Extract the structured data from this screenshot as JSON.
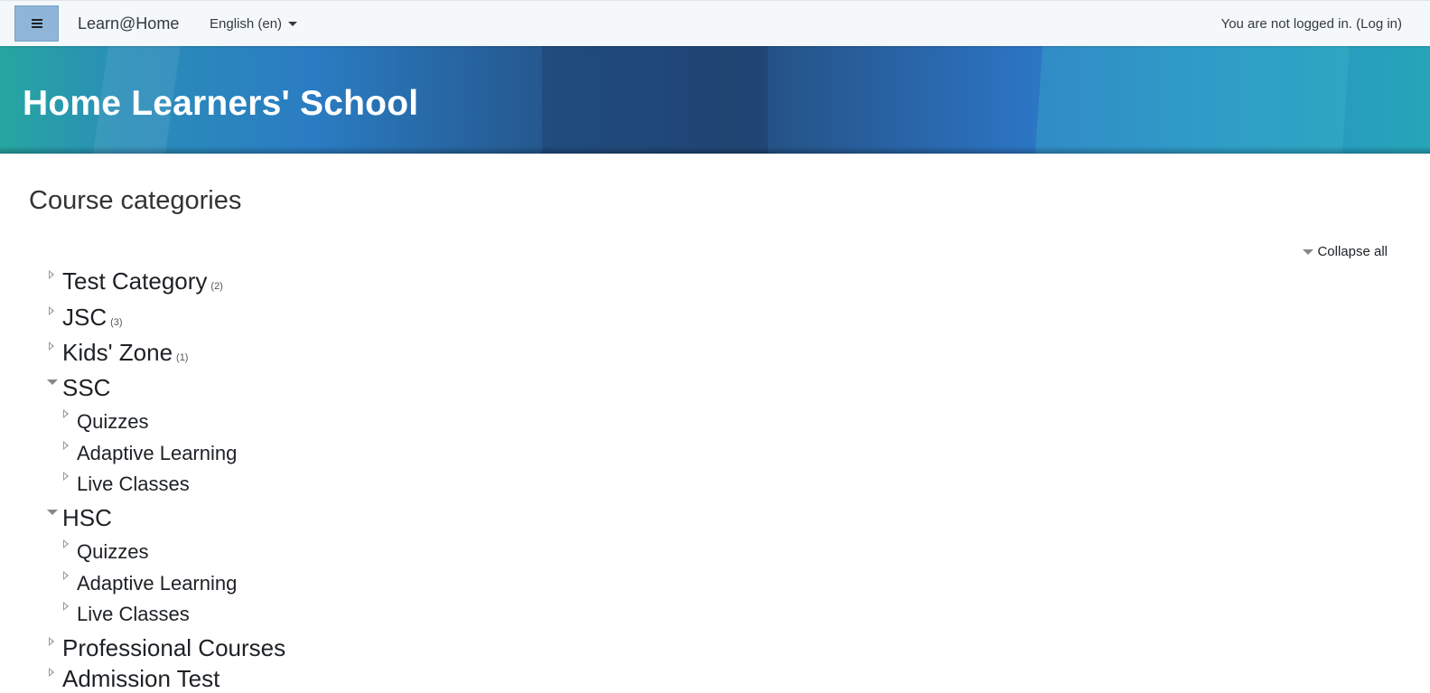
{
  "navbar": {
    "menu_icon": "hamburger-icon",
    "site_name": "Learn@Home",
    "language": "English (en)",
    "login_text": "You are not logged in.",
    "login_link": "(Log in)"
  },
  "banner": {
    "title": "Home Learners' School"
  },
  "main": {
    "heading": "Course categories",
    "collapse_all": "Collapse all",
    "categories": [
      {
        "name": "Test Category",
        "count": "(2)",
        "expanded": false
      },
      {
        "name": "JSC",
        "count": "(3)",
        "expanded": false
      },
      {
        "name": "Kids' Zone",
        "count": "(1)",
        "expanded": false
      },
      {
        "name": "SSC",
        "expanded": true,
        "children": [
          {
            "name": "Quizzes"
          },
          {
            "name": "Adaptive Learning"
          },
          {
            "name": "Live Classes"
          }
        ]
      },
      {
        "name": "HSC",
        "expanded": true,
        "children": [
          {
            "name": "Quizzes"
          },
          {
            "name": "Adaptive Learning"
          },
          {
            "name": "Live Classes"
          }
        ]
      },
      {
        "name": "Professional Courses",
        "expanded": false
      },
      {
        "name": "Admission Test",
        "expanded": false
      }
    ]
  },
  "colors": {
    "navbar_bg": "#f4f8fb",
    "menu_button_bg": "#8fb5d9",
    "banner_title": "#ffffff",
    "toggle_icon": "#999999"
  }
}
